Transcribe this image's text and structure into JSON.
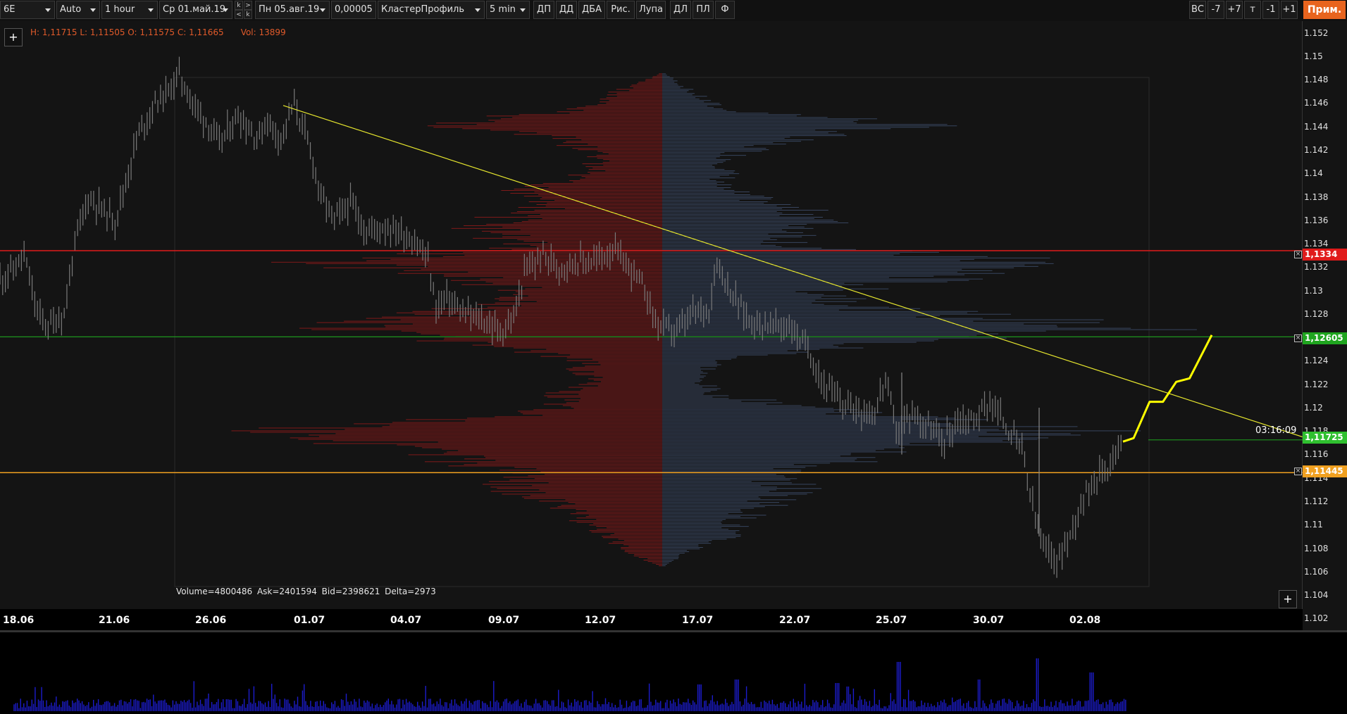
{
  "toolbar": {
    "symbol": "6E",
    "scale": "Auto",
    "timeframe": "1 hour",
    "date_from": "Ср 01.май.19",
    "date_to": "Пн 05.авг.19",
    "tick_size": "0,00005",
    "template": "КластерПрофиль",
    "profile_tf": "5 min",
    "buttons": [
      "ДП",
      "ДД",
      "ДБА",
      "Рис.",
      "Лупа",
      "ДЛ",
      "ПЛ",
      "Ф"
    ],
    "nav_left": [
      "k",
      "<"
    ],
    "nav_right": [
      ">",
      "k"
    ],
    "right_buttons": [
      "ВС",
      "-7",
      "+7",
      "т",
      "-1",
      "+1"
    ],
    "prim_label": "Прим."
  },
  "header": {
    "ohlc": "H: 1,11715 L: 1,11505 O: 1,11575 C: 1,11665",
    "volume": "Vol: 13899",
    "plus": "+"
  },
  "stats": "Volume=4800486 Ask=2401594 Bid=2398621 Delta=2973",
  "timer": "03:16:09",
  "price_tags": {
    "red": "1,1334",
    "green": "1,12605",
    "current": "1,11725",
    "orange": "1,11445",
    "close_symbol": "×"
  },
  "colors": {
    "red_line": "#e01b1b",
    "green_line": "#1fa51f",
    "orange_line": "#f0a020",
    "trendline": "#e6e62e",
    "projection": "#ffff00",
    "ask_profile": "#8a1a1a",
    "bid_profile": "#3b4a66",
    "volume_bars": "#1c1ccc"
  },
  "chart_data": {
    "type": "candlestick",
    "ylim": [
      1.101,
      1.153
    ],
    "y_ticks": [
      "1.152",
      "1.15",
      "1.148",
      "1.146",
      "1.144",
      "1.142",
      "1.14",
      "1.138",
      "1.136",
      "1.134",
      "1.132",
      "1.13",
      "1.128",
      "1.126",
      "1.124",
      "1.122",
      "1.12",
      "1.118",
      "1.116",
      "1.114",
      "1.112",
      "1.11",
      "1.108",
      "1.106",
      "1.104",
      "1.102"
    ],
    "x_ticks": [
      "18.06",
      "21.06",
      "26.06",
      "01.07",
      "04.07",
      "09.07",
      "12.07",
      "17.07",
      "22.07",
      "25.07",
      "30.07",
      "02.08"
    ],
    "price_path": [
      [
        0,
        1.131
      ],
      [
        6,
        1.132
      ],
      [
        9,
        1.133
      ],
      [
        14,
        1.128
      ],
      [
        18,
        1.127
      ],
      [
        24,
        1.128
      ],
      [
        28,
        1.134
      ],
      [
        33,
        1.138
      ],
      [
        38,
        1.137
      ],
      [
        43,
        1.136
      ],
      [
        48,
        1.14
      ],
      [
        51,
        1.143
      ],
      [
        58,
        1.146
      ],
      [
        63,
        1.147
      ],
      [
        67,
        1.1485
      ],
      [
        72,
        1.146
      ],
      [
        77,
        1.1445
      ],
      [
        82,
        1.1425
      ],
      [
        89,
        1.145
      ],
      [
        96,
        1.143
      ],
      [
        100,
        1.1445
      ],
      [
        105,
        1.143
      ],
      [
        110,
        1.146
      ],
      [
        116,
        1.142
      ],
      [
        120,
        1.138
      ],
      [
        125,
        1.136
      ],
      [
        131,
        1.1375
      ],
      [
        137,
        1.135
      ],
      [
        143,
        1.1355
      ],
      [
        150,
        1.135
      ],
      [
        156,
        1.134
      ],
      [
        160,
        1.1325
      ],
      [
        163,
        1.1285
      ],
      [
        167,
        1.1295
      ],
      [
        173,
        1.128
      ],
      [
        180,
        1.1275
      ],
      [
        187,
        1.1265
      ],
      [
        192,
        1.1275
      ],
      [
        196,
        1.1315
      ],
      [
        203,
        1.133
      ],
      [
        209,
        1.132
      ],
      [
        215,
        1.1325
      ],
      [
        222,
        1.1325
      ],
      [
        229,
        1.1335
      ],
      [
        235,
        1.132
      ],
      [
        240,
        1.1305
      ],
      [
        246,
        1.127
      ],
      [
        253,
        1.1265
      ],
      [
        259,
        1.128
      ],
      [
        265,
        1.1285
      ],
      [
        268,
        1.1325
      ],
      [
        274,
        1.1295
      ],
      [
        280,
        1.1275
      ],
      [
        288,
        1.127
      ],
      [
        295,
        1.127
      ],
      [
        302,
        1.125
      ],
      [
        308,
        1.122
      ],
      [
        314,
        1.1205
      ],
      [
        320,
        1.12
      ],
      [
        327,
        1.1195
      ],
      [
        331,
        1.1225
      ],
      [
        335,
        1.118
      ],
      [
        341,
        1.1195
      ],
      [
        347,
        1.1185
      ],
      [
        352,
        1.117
      ],
      [
        358,
        1.119
      ],
      [
        364,
        1.119
      ],
      [
        370,
        1.1205
      ],
      [
        376,
        1.1185
      ],
      [
        382,
        1.1165
      ],
      [
        386,
        1.1115
      ],
      [
        390,
        1.108
      ],
      [
        395,
        1.107
      ],
      [
        400,
        1.109
      ],
      [
        404,
        1.112
      ],
      [
        409,
        1.114
      ],
      [
        414,
        1.115
      ],
      [
        418,
        1.1165
      ],
      [
        420,
        1.11725
      ]
    ],
    "projection": [
      [
        1.1171,
        0.0
      ],
      [
        1.1174,
        0.12
      ],
      [
        1.1205,
        0.3
      ],
      [
        1.1205,
        0.45
      ],
      [
        1.1222,
        0.6
      ],
      [
        1.1225,
        0.75
      ],
      [
        1.1262,
        1.0
      ]
    ],
    "trendline": [
      [
        1.1458,
        "01.07"
      ],
      [
        1.1175,
        "end"
      ]
    ],
    "horizontal_levels": [
      1.1334,
      1.12605,
      1.11725,
      1.11445
    ],
    "volume_profile": {
      "center_price_range": [
        1.1065,
        1.1485
      ],
      "split": "ask left / bid right"
    },
    "volume_spike_days": [
      "22.07",
      "25.07",
      "30.07",
      "02.08"
    ]
  }
}
